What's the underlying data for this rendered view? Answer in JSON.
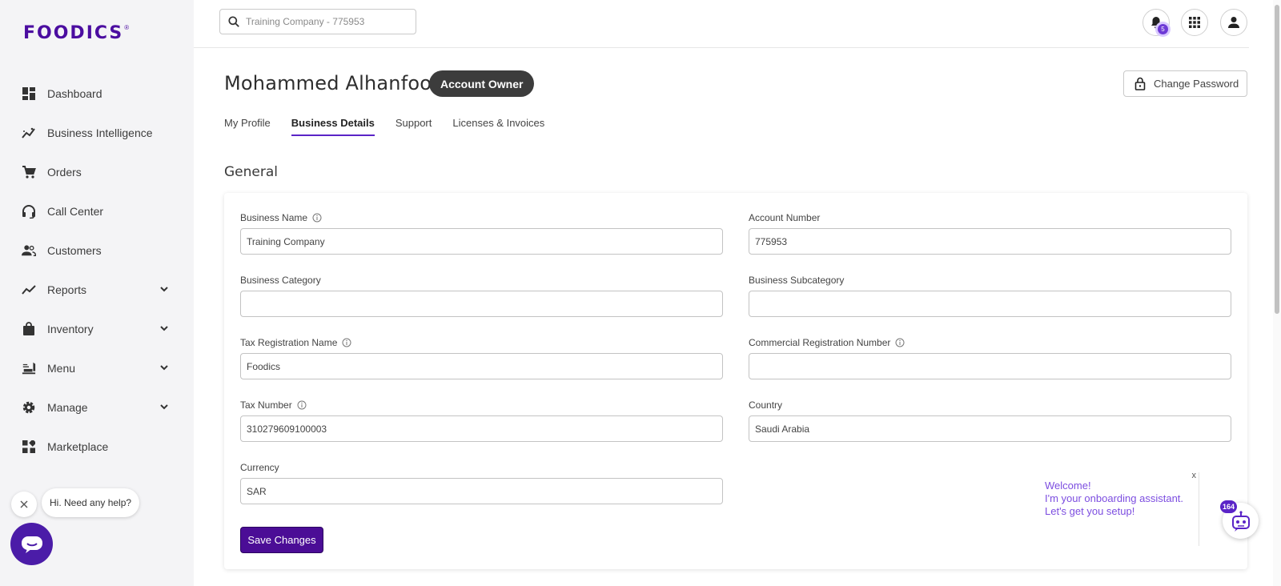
{
  "brand": {
    "name": "FOODICS",
    "mark": "®",
    "accent": "#4b0da0"
  },
  "sidebar": {
    "items": [
      {
        "label": "Dashboard",
        "icon": "dashboard-icon",
        "expandable": false
      },
      {
        "label": "Business Intelligence",
        "icon": "insights-icon",
        "expandable": false
      },
      {
        "label": "Orders",
        "icon": "cart-icon",
        "expandable": false
      },
      {
        "label": "Call Center",
        "icon": "headset-icon",
        "expandable": false
      },
      {
        "label": "Customers",
        "icon": "people-icon",
        "expandable": false
      },
      {
        "label": "Reports",
        "icon": "trending-icon",
        "expandable": true
      },
      {
        "label": "Inventory",
        "icon": "bag-icon",
        "expandable": true
      },
      {
        "label": "Menu",
        "icon": "menu-food-icon",
        "expandable": true
      },
      {
        "label": "Manage",
        "icon": "gear-icon",
        "expandable": true
      },
      {
        "label": "Marketplace",
        "icon": "widgets-icon",
        "expandable": false
      }
    ]
  },
  "help": {
    "bubble_text": "Hi. Need any help?"
  },
  "topbar": {
    "search_placeholder": "Training Company - 775953",
    "notification_count": "5"
  },
  "header": {
    "user_name": "Mohammed Alhanfoosh",
    "role_badge": "Account Owner",
    "change_password_label": "Change Password"
  },
  "tabs": [
    {
      "label": "My Profile",
      "active": false
    },
    {
      "label": "Business Details",
      "active": true
    },
    {
      "label": "Support",
      "active": false
    },
    {
      "label": "Licenses & Invoices",
      "active": false
    }
  ],
  "section_title": "General",
  "form": {
    "business_name": {
      "label": "Business Name",
      "value": "Training Company",
      "info": true
    },
    "account_number": {
      "label": "Account Number",
      "value": "775953",
      "info": false
    },
    "business_category": {
      "label": "Business Category",
      "value": "",
      "info": false
    },
    "business_subcategory": {
      "label": "Business Subcategory",
      "value": "",
      "info": false
    },
    "tax_registration_name": {
      "label": "Tax Registration Name",
      "value": "Foodics",
      "info": true
    },
    "commercial_registration_number": {
      "label": "Commercial Registration Number",
      "value": "",
      "info": true
    },
    "tax_number": {
      "label": "Tax Number",
      "value": "310279609100003",
      "info": true
    },
    "country": {
      "label": "Country",
      "value": "Saudi Arabia",
      "info": false
    },
    "currency": {
      "label": "Currency",
      "value": "SAR",
      "info": false
    },
    "save_label": "Save Changes"
  },
  "onboarding": {
    "line1": "Welcome!",
    "line2": "I'm your onboarding assistant.",
    "line3": "Let's get you setup!",
    "close": "x",
    "badge": "164"
  },
  "colors": {
    "primary": "#4b0d96",
    "tab_underline": "#5a24c7",
    "onboard_text": "#7c4de0",
    "badge_dark": "#3c3c3c"
  }
}
